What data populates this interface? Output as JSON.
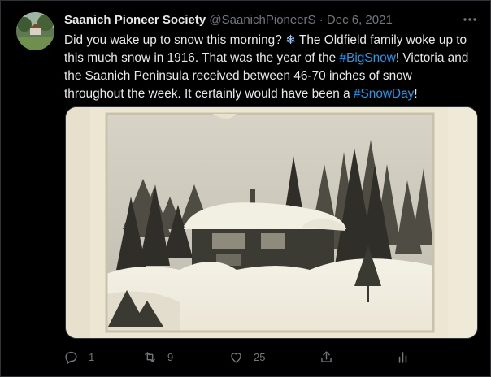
{
  "tweet": {
    "author_name": "Saanich Pioneer Society",
    "author_handle": "@SaanichPioneerS",
    "separator": "·",
    "date": "Dec 6, 2021",
    "text_parts": {
      "p1": "Did you wake up to snow this morning? ",
      "snow_emoji": "❄",
      "p2": " The Oldfield family woke up to this much snow in 1916. That was the year of the ",
      "hashtag1": "#BigSnow",
      "p3": "! Victoria and the Saanich Peninsula received between 46-70 inches of snow throughout the week. It certainly would have been a ",
      "hashtag2": "#SnowDay",
      "p4": "!"
    }
  },
  "actions": {
    "reply_count": "1",
    "retweet_count": "9",
    "like_count": "25"
  },
  "icons": {
    "avatar": "avatar-photo",
    "more": "more-icon",
    "reply": "reply-icon",
    "retweet": "retweet-icon",
    "like": "heart-icon",
    "share": "share-icon",
    "analytics": "analytics-icon"
  },
  "colors": {
    "background": "#000000",
    "text": "#e7e9ea",
    "muted": "#71767b",
    "link": "#1d9bf0"
  }
}
